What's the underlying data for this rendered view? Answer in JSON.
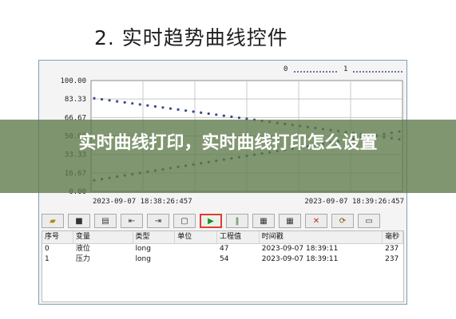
{
  "heading": "2. 实时趋势曲线控件",
  "legend": {
    "labels": [
      "0",
      "1"
    ]
  },
  "chart_data": {
    "type": "line",
    "y_ticks": [
      "100.00",
      "83.33",
      "66.67",
      "50.00",
      "33.33",
      "16.67",
      "0.00"
    ],
    "ylim": [
      0,
      100
    ],
    "x_start": "2023-09-07  18:38:26:457",
    "x_end": "2023-09-07  18:39:26:457",
    "grid": true,
    "series": [
      {
        "name": "0",
        "start": 84,
        "end": 47,
        "color": "#3c4a8c"
      },
      {
        "name": "1",
        "start": 10,
        "end": 54,
        "color": "#3c4a8c"
      }
    ]
  },
  "toolbar": [
    "open",
    "save",
    "print",
    "back",
    "forward",
    "new",
    "play",
    "pause",
    "table",
    "table2",
    "close",
    "export",
    "window"
  ],
  "table": {
    "headers": [
      "序号",
      "变量",
      "类型",
      "单位",
      "工程值",
      "时间戳",
      "毫秒"
    ],
    "rows": [
      [
        "0",
        "液位",
        "long",
        "",
        "47",
        "2023-09-07 18:39:11",
        "237"
      ],
      [
        "1",
        "压力",
        "long",
        "",
        "54",
        "2023-09-07 18:39:11",
        "237"
      ]
    ]
  },
  "banner": "实时曲线打印，实时曲线打印怎么设置"
}
